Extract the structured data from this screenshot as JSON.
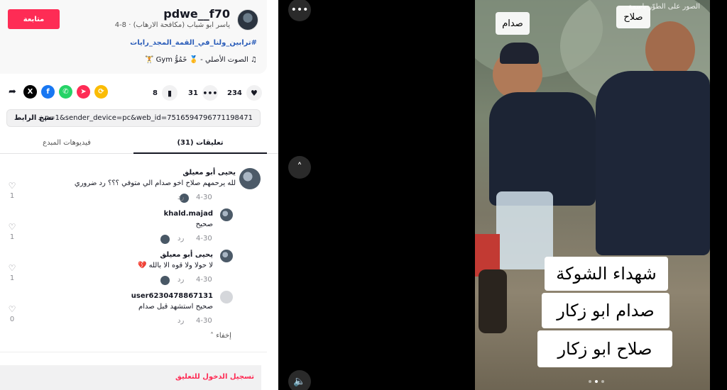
{
  "author": {
    "follow_label": "متابعة",
    "username": "pdwe__f70",
    "display_name": "ياسر ابو شباب (مكافحة الارهاب)",
    "date": "8-4",
    "hashtag": "#ترابين_ولنا_في_القمة_المجد_رايات",
    "sound": "الصوت الأصلي - 🥇 خَمُوُّ Gym 🏋"
  },
  "stats": {
    "likes": "234",
    "comments": "31",
    "saves": "8"
  },
  "share_icons": [
    "repost-icon",
    "telegram-icon",
    "whatsapp-icon",
    "facebook-icon",
    "x-icon",
    "share-arrow-icon"
  ],
  "link": {
    "copy_label": "نسخ الرابط",
    "url": "...p=1&sender_device=pc&web_id=7516594796771198471"
  },
  "tabs": {
    "comments": "تعليقات (31)",
    "creator_videos": "فيديوهات المبدع"
  },
  "comments": [
    {
      "name": "يحيى أبو معيلق",
      "text": "لله يرحمهم صلاح اخو صدام الي متوفي ؟؟؟ رد ضروري",
      "date": "4-30",
      "reply": "رد",
      "likes": "1"
    },
    {
      "name": "khald.majad",
      "text": "صحيح",
      "date": "4-30",
      "reply": "رد",
      "likes": "1"
    },
    {
      "name": "يحيى أبو معيلق",
      "text": "لا حولا ولا قوه الا بالله 💔",
      "date": "4-30",
      "reply": "رد",
      "likes": "1"
    },
    {
      "name": "user6230478867131",
      "text": "صحيح استشهد قبل صدام",
      "date": "4-30",
      "reply": "رد",
      "likes": "0"
    }
  ],
  "hide_label": "إخفاء",
  "login_label": "تسجيل الدخول للتعليق",
  "video": {
    "label_saddam": "صدام",
    "label_salah": "صلاح",
    "overlay_top": "الصور على الطوّر باسمة",
    "caption_1": "شهداء الشوكة",
    "caption_2": "صدام ابو زكار",
    "caption_3": "صلاح ابو زكار"
  },
  "colors": {
    "accent": "#fe2c55",
    "hashtag": "#2b5db9"
  }
}
